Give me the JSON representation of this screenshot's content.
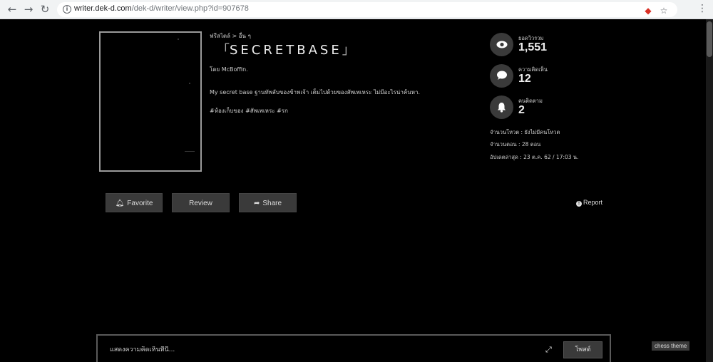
{
  "browser": {
    "url_host": "writer.dek-d.com",
    "url_path": "/dek-d/writer/view.php?id=907678"
  },
  "story": {
    "breadcrumb": "ฟรีสไตล์ > อื่น ๆ",
    "title_open": "「",
    "title": "SECRETBASE",
    "title_close": "」",
    "author": "โดย McBoffin.",
    "description": "My secret base ฐานทัพลับของข้าพเจ้า เต็มไปด้วยของสัพเพเหระ ไม่มีอะไรน่าค้นหา.",
    "tags": "#ห้องเก็บของ #สัพเพเหระ #รก"
  },
  "stats": {
    "views_label": "ยอดวิวรวม",
    "views_value": "1,551",
    "comments_label": "ความคิดเห็น",
    "comments_value": "12",
    "followers_label": "คนติดตาม",
    "followers_value": "2",
    "votes": "จำนวนโหวต : ยังไม่มีคนโหวต",
    "episodes": "จำนวนตอน : 28 ตอน",
    "updated": "อัปเดตล่าสุด :  23 ต.ค. 62 / 17:03 น."
  },
  "actions": {
    "favorite": "Favorite",
    "review": "Review",
    "share": "Share",
    "report": "Report"
  },
  "comment": {
    "placeholder": "แสดงความคิดเห็นที่นี่...",
    "post": "โพสต์"
  },
  "theme_badge": "chess theme"
}
